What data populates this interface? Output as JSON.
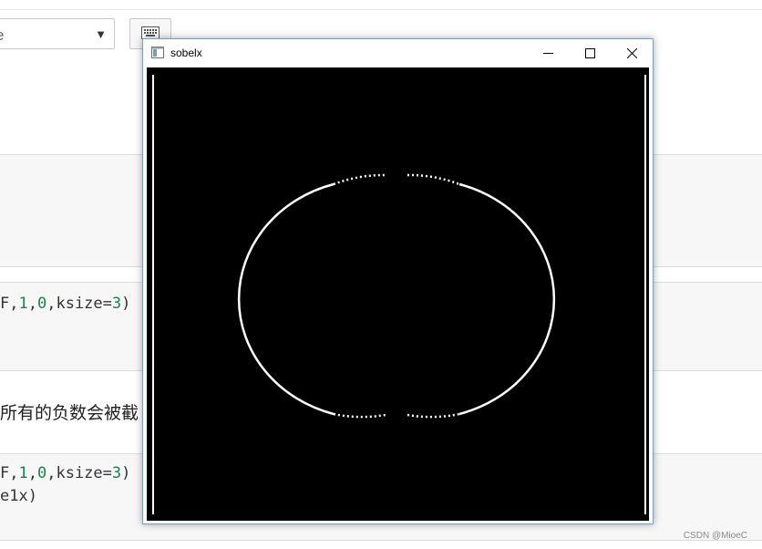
{
  "toolbar": {
    "celltype_value": "e",
    "celltype_arrow": "▼",
    "keyboard_icon": "keyboard-icon"
  },
  "code_cells": [
    {
      "line": "F,1,0,ksize=3)"
    },
    {
      "line": "F,1,0,ksize=3)"
    },
    {
      "line": "e1x)"
    }
  ],
  "markdown_text": "所有的负数会被截",
  "watermark": "CSDN @MioeC",
  "cv_window": {
    "title": "sobelx",
    "minimize_glyph": "minimize-icon",
    "maximize_glyph": "maximize-icon",
    "close_glyph": "close-icon",
    "background": "#000000",
    "edge_color": "#ffffff"
  }
}
